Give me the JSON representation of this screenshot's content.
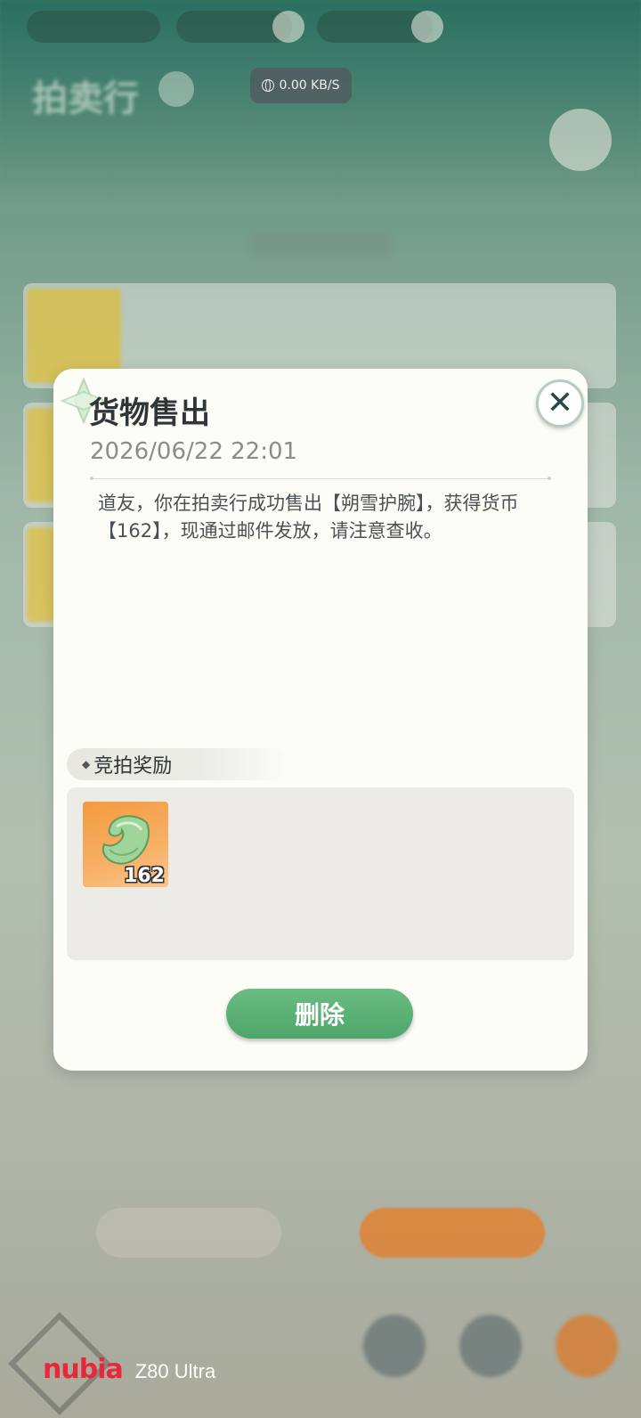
{
  "network": {
    "speed": "0.00 KB/S"
  },
  "dialog": {
    "title": "货物售出",
    "date": "2026/06/22 22:01",
    "body": "道友，你在拍卖行成功售出【朔雪护腕】，获得货币【162】，现通过邮件发放，请注意查收。",
    "reward_label": "竞拍奖励",
    "reward_items": [
      {
        "icon": "jade-currency-icon",
        "count": "162"
      }
    ],
    "delete_label": "删除",
    "close_icon": "close-icon"
  },
  "watermark": {
    "brand": "nubia",
    "model": "Z80 Ultra"
  },
  "colors": {
    "accent_green": "#4ea56a",
    "brand_red": "#e8283a",
    "item_bg": "#f39a3f"
  }
}
